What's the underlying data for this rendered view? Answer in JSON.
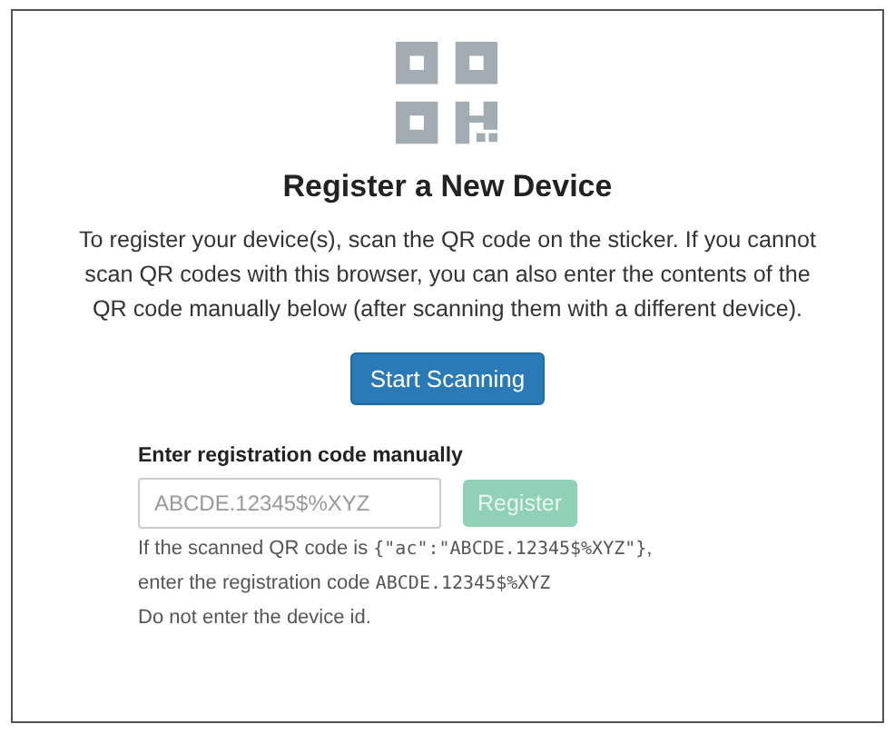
{
  "title": "Register a New Device",
  "intro": "To register your device(s), scan the QR code on the sticker. If you cannot scan QR codes with this browser, you can also enter the contents of the QR code manually below (after scanning them with a different device).",
  "scan_button": {
    "label": "Start Scanning"
  },
  "manual": {
    "label": "Enter registration code manually",
    "placeholder": "ABCDE.12345$%XYZ",
    "register_button": {
      "label": "Register",
      "disabled": true
    }
  },
  "hints": [
    {
      "parts": [
        {
          "kind": "text",
          "text": "If the scanned QR code is "
        },
        {
          "kind": "code",
          "text": "{\"ac\":\"ABCDE.12345$%XYZ\"}"
        },
        {
          "kind": "text",
          "text": ","
        }
      ]
    },
    {
      "parts": [
        {
          "kind": "text",
          "text": "enter the registration code "
        },
        {
          "kind": "code",
          "text": "ABCDE.12345$%XYZ"
        }
      ]
    },
    {
      "parts": [
        {
          "kind": "text",
          "text": "Do not enter the device id."
        }
      ]
    }
  ]
}
